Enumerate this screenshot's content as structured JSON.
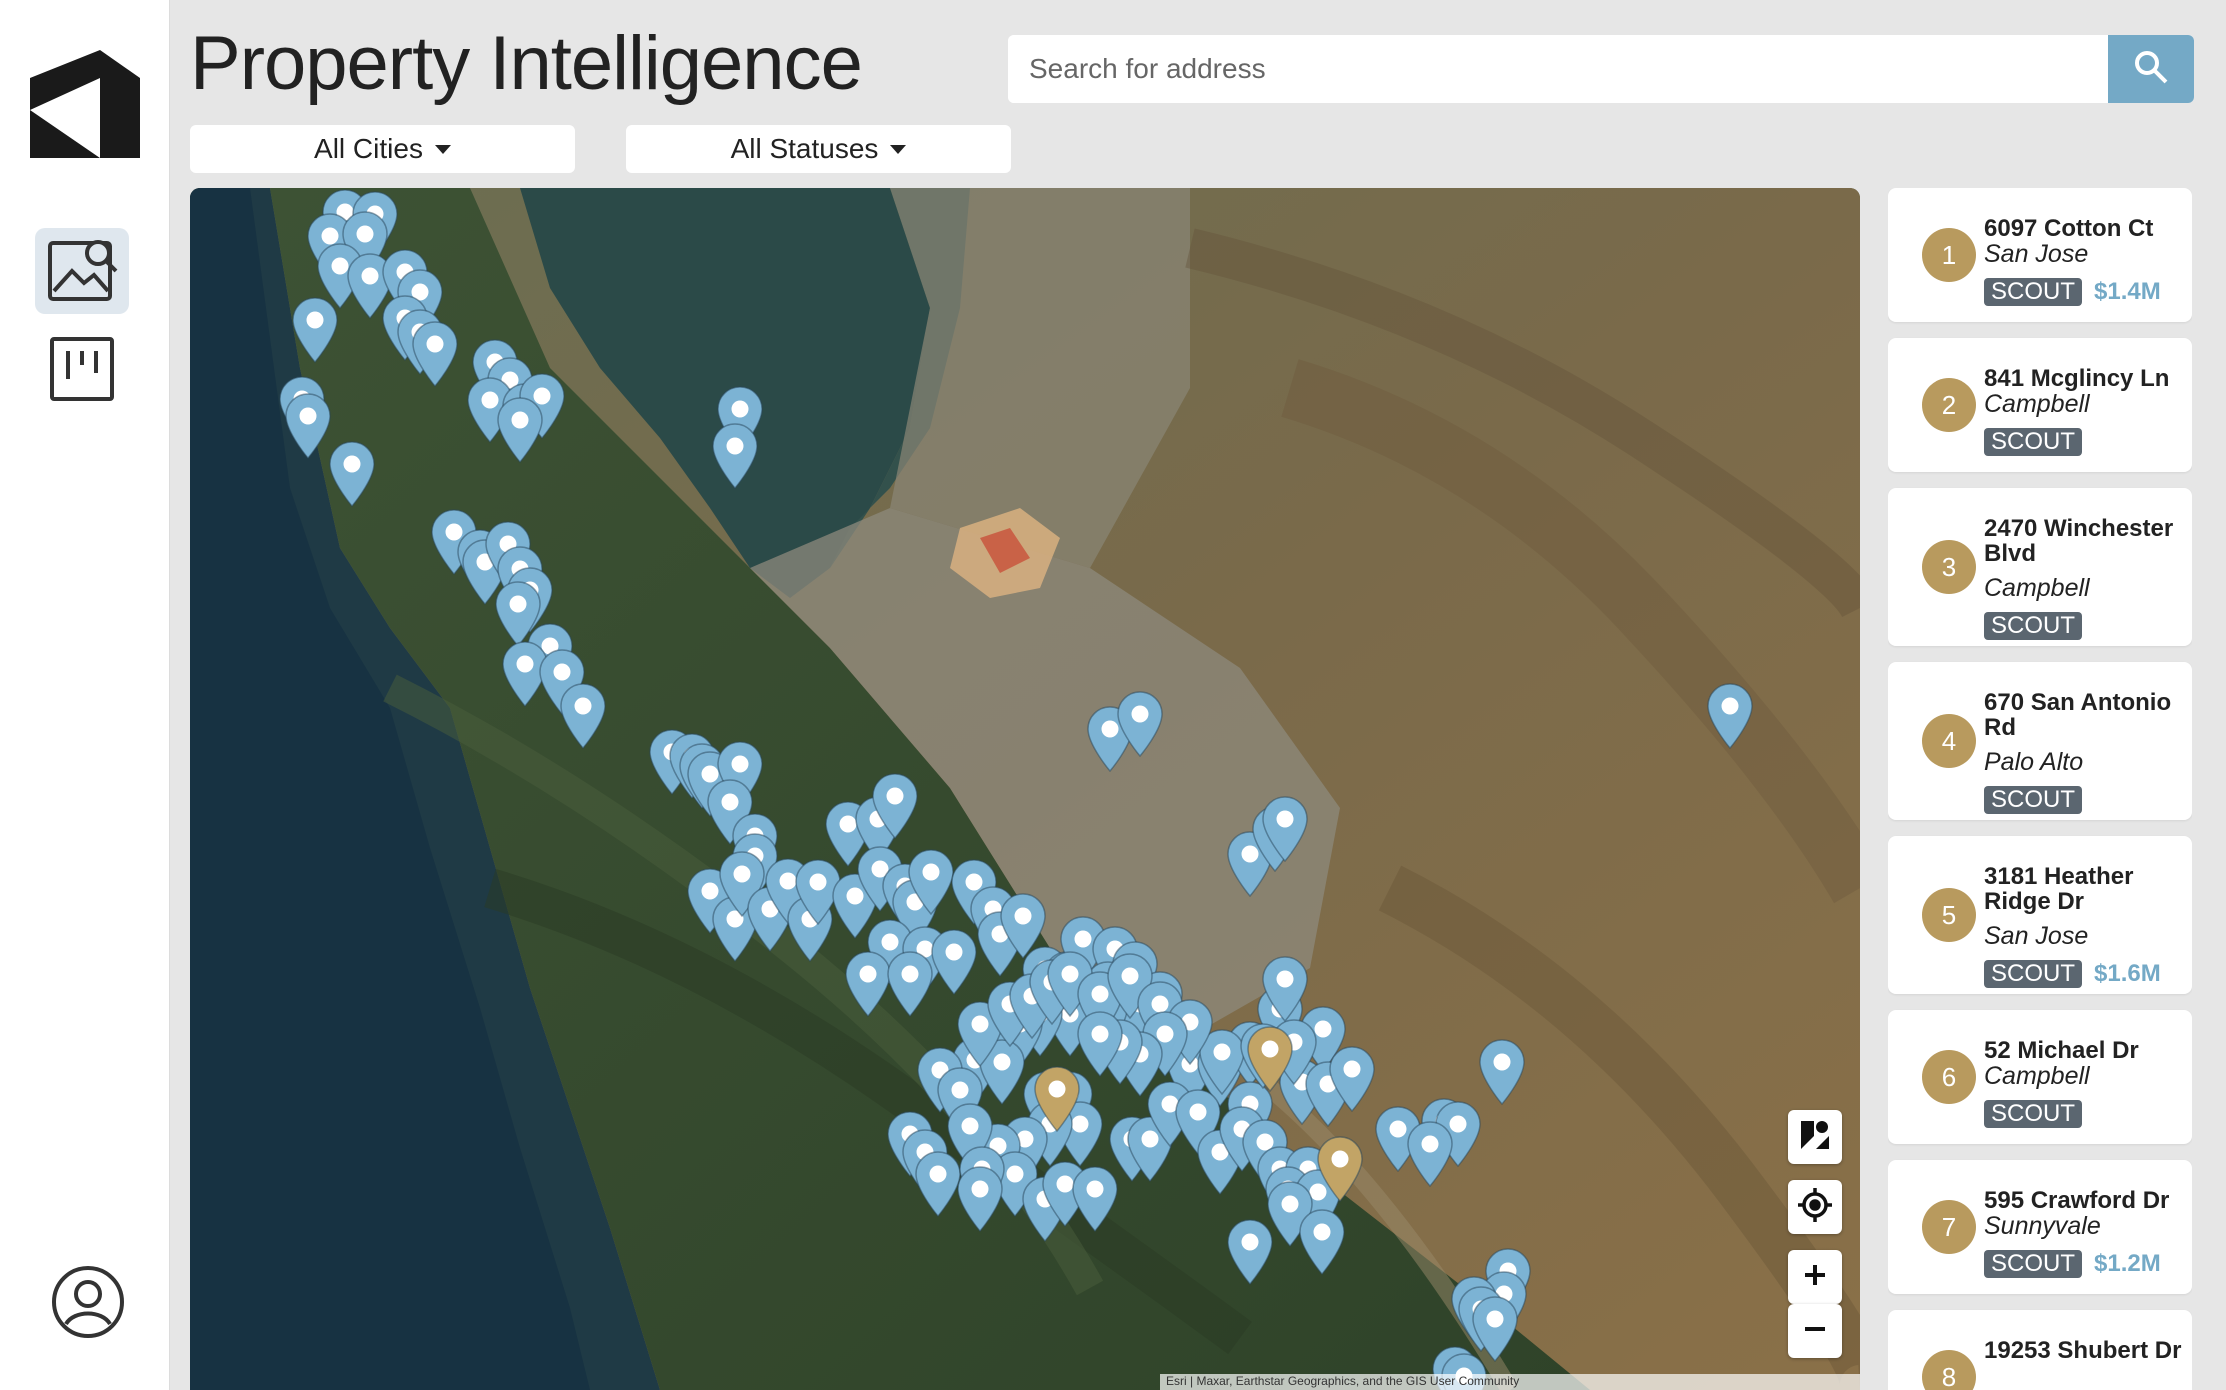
{
  "app": {
    "title": "Property Intelligence"
  },
  "rail": {
    "logo_icon": "house-logo-icon",
    "items": [
      {
        "icon": "image-search-icon",
        "active": true
      },
      {
        "icon": "board-icon",
        "active": false
      }
    ],
    "profile_icon": "user-avatar-icon"
  },
  "search": {
    "placeholder": "Search for address",
    "value": "",
    "icon": "search-icon"
  },
  "filters": {
    "cities": "All Cities",
    "statuses": "All Statuses"
  },
  "map": {
    "controls": [
      "layers-icon",
      "locate-icon",
      "zoom-in-icon",
      "zoom-out-icon"
    ],
    "attribution": "Esri | Maxar, Earthstar Geographics, and the GIS User Community",
    "marker_colors": {
      "default": "#7cb3d4",
      "highlight": "#c2a466"
    }
  },
  "listings": [
    {
      "num": "1",
      "address": "6097 Cotton Ct",
      "city": "San Jose",
      "status": "SCOUT",
      "price": "$1.4M"
    },
    {
      "num": "2",
      "address": "841 Mcglincy Ln",
      "city": "Campbell",
      "status": "SCOUT",
      "price": ""
    },
    {
      "num": "3",
      "address": "2470 Winchester Blvd",
      "city": "Campbell",
      "status": "SCOUT",
      "price": ""
    },
    {
      "num": "4",
      "address": "670 San Antonio Rd",
      "city": "Palo Alto",
      "status": "SCOUT",
      "price": ""
    },
    {
      "num": "5",
      "address": "3181 Heather Ridge Dr",
      "city": "San Jose",
      "status": "SCOUT",
      "price": "$1.6M"
    },
    {
      "num": "6",
      "address": "52 Michael Dr",
      "city": "Campbell",
      "status": "SCOUT",
      "price": ""
    },
    {
      "num": "7",
      "address": "595 Crawford Dr",
      "city": "Sunnyvale",
      "status": "SCOUT",
      "price": "$1.2M"
    },
    {
      "num": "8",
      "address": "19253 Shubert Dr",
      "city": "",
      "status": "",
      "price": ""
    }
  ]
}
